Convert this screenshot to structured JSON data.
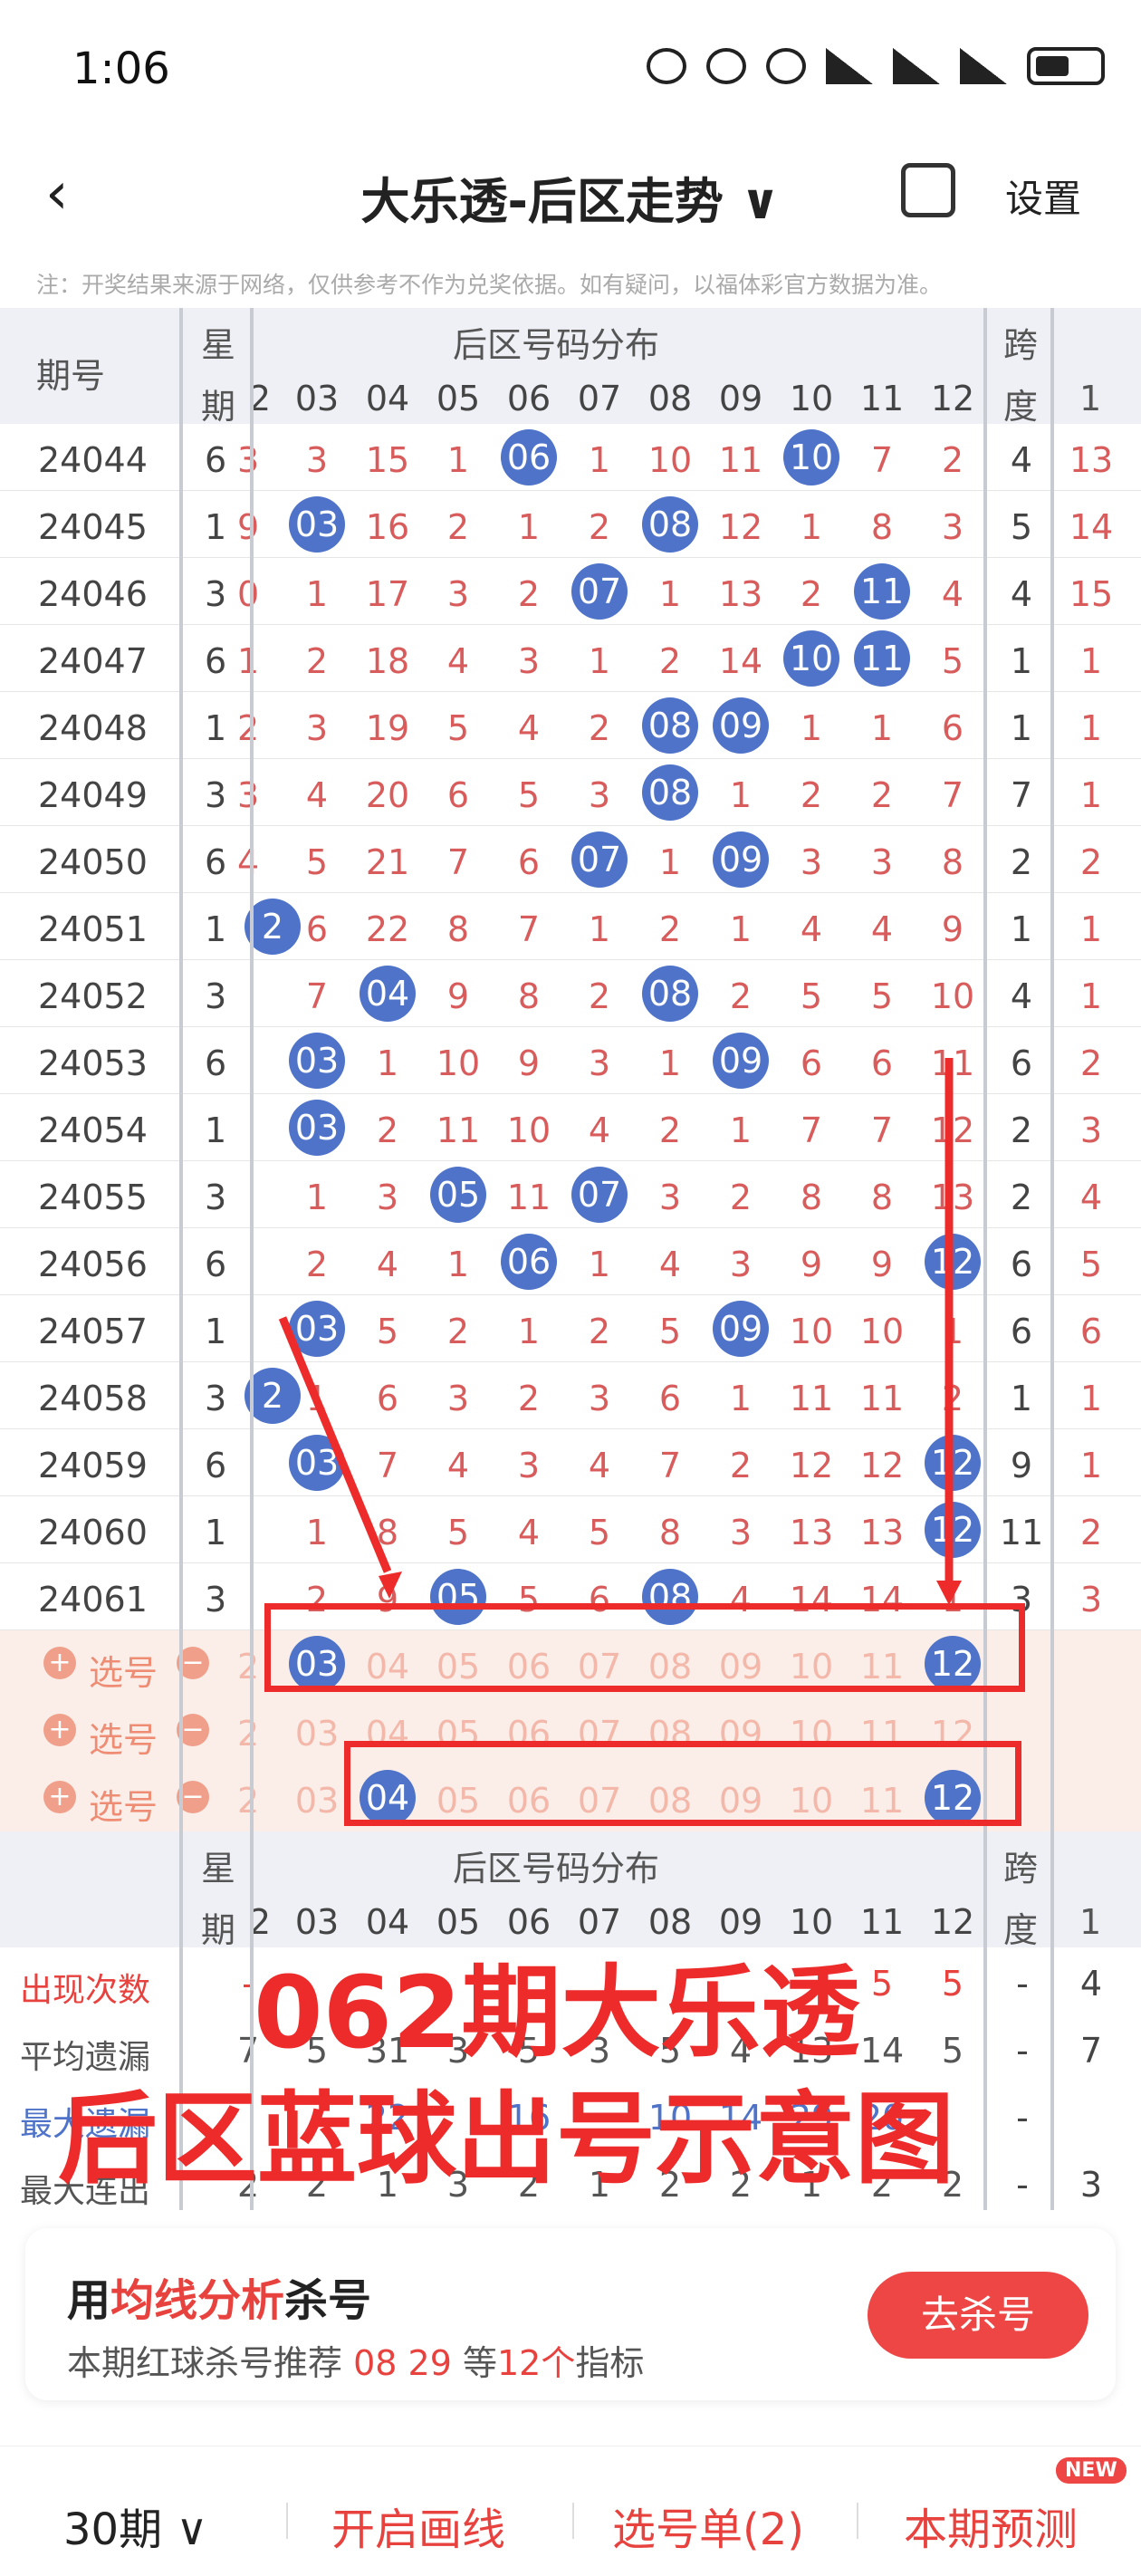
{
  "status": {
    "time": "1:06"
  },
  "nav": {
    "title": "大乐透-后区走势 ∨",
    "settings": "设置"
  },
  "notice": "注：开奖结果来源于网络，仅供参考不作为兑奖依据。如有疑问，以福体彩官方数据为准。",
  "header": {
    "issue_label": "期号",
    "week_label_1": "星",
    "week_label_2": "期",
    "dist_label": "后区号码分布",
    "span_label_1": "跨",
    "span_label_2": "度",
    "extra_col": "1",
    "columns": [
      "2",
      "03",
      "04",
      "05",
      "06",
      "07",
      "08",
      "09",
      "10",
      "11",
      "12"
    ]
  },
  "rows": [
    {
      "issue": "24044",
      "wk": "6",
      "cells": [
        "3",
        "3",
        "15",
        "1",
        "06",
        "1",
        "10",
        "11",
        "10",
        "7",
        "2"
      ],
      "span": "4",
      "s1": "13"
    },
    {
      "issue": "24045",
      "wk": "1",
      "cells": [
        "9",
        "03",
        "16",
        "2",
        "1",
        "2",
        "08",
        "12",
        "1",
        "8",
        "3"
      ],
      "span": "5",
      "s1": "14"
    },
    {
      "issue": "24046",
      "wk": "3",
      "cells": [
        "0",
        "1",
        "17",
        "3",
        "2",
        "07",
        "1",
        "13",
        "2",
        "11",
        "4"
      ],
      "span": "4",
      "s1": "15"
    },
    {
      "issue": "24047",
      "wk": "6",
      "cells": [
        "1",
        "2",
        "18",
        "4",
        "3",
        "1",
        "2",
        "14",
        "10",
        "11",
        "5"
      ],
      "span": "1",
      "s1": "1"
    },
    {
      "issue": "24048",
      "wk": "1",
      "cells": [
        "2",
        "3",
        "19",
        "5",
        "4",
        "2",
        "08",
        "09",
        "1",
        "1",
        "6"
      ],
      "span": "1",
      "s1": "1"
    },
    {
      "issue": "24049",
      "wk": "3",
      "cells": [
        "3",
        "4",
        "20",
        "6",
        "5",
        "3",
        "08",
        "1",
        "2",
        "2",
        "7"
      ],
      "span": "7",
      "s1": "1"
    },
    {
      "issue": "24050",
      "wk": "6",
      "cells": [
        "4",
        "5",
        "21",
        "7",
        "6",
        "07",
        "1",
        "09",
        "3",
        "3",
        "8"
      ],
      "span": "2",
      "s1": "2"
    },
    {
      "issue": "24051",
      "wk": "1",
      "cells": [
        "2",
        "6",
        "22",
        "8",
        "7",
        "1",
        "2",
        "1",
        "4",
        "4",
        "9"
      ],
      "span": "1",
      "s1": "1"
    },
    {
      "issue": "24052",
      "wk": "3",
      "cells": [
        "",
        "7",
        "04",
        "9",
        "8",
        "2",
        "08",
        "2",
        "5",
        "5",
        "10"
      ],
      "span": "4",
      "s1": "1"
    },
    {
      "issue": "24053",
      "wk": "6",
      "cells": [
        "",
        "03",
        "1",
        "10",
        "9",
        "3",
        "1",
        "09",
        "6",
        "6",
        "11"
      ],
      "span": "6",
      "s1": "2"
    },
    {
      "issue": "24054",
      "wk": "1",
      "cells": [
        "",
        "03",
        "2",
        "11",
        "10",
        "4",
        "2",
        "1",
        "7",
        "7",
        "12"
      ],
      "span": "2",
      "s1": "3"
    },
    {
      "issue": "24055",
      "wk": "3",
      "cells": [
        "",
        "1",
        "3",
        "05",
        "11",
        "07",
        "3",
        "2",
        "8",
        "8",
        "13"
      ],
      "span": "2",
      "s1": "4"
    },
    {
      "issue": "24056",
      "wk": "6",
      "cells": [
        "",
        "2",
        "4",
        "1",
        "06",
        "1",
        "4",
        "3",
        "9",
        "9",
        "12"
      ],
      "span": "6",
      "s1": "5"
    },
    {
      "issue": "24057",
      "wk": "1",
      "cells": [
        "",
        "03",
        "5",
        "2",
        "1",
        "2",
        "5",
        "09",
        "10",
        "10",
        "1"
      ],
      "span": "6",
      "s1": "6"
    },
    {
      "issue": "24058",
      "wk": "3",
      "cells": [
        "2",
        "1",
        "6",
        "3",
        "2",
        "3",
        "6",
        "1",
        "11",
        "11",
        "2"
      ],
      "span": "1",
      "s1": "1"
    },
    {
      "issue": "24059",
      "wk": "6",
      "cells": [
        "",
        "03",
        "7",
        "4",
        "3",
        "4",
        "7",
        "2",
        "12",
        "12",
        "12"
      ],
      "span": "9",
      "s1": "1"
    },
    {
      "issue": "24060",
      "wk": "1",
      "cells": [
        "",
        "1",
        "8",
        "5",
        "4",
        "5",
        "8",
        "3",
        "13",
        "13",
        "12"
      ],
      "span": "11",
      "s1": "2"
    },
    {
      "issue": "24061",
      "wk": "3",
      "cells": [
        "",
        "2",
        "9",
        "05",
        "5",
        "6",
        "08",
        "4",
        "14",
        "14",
        "1"
      ],
      "span": "3",
      "s1": "3"
    }
  ],
  "balls": [
    [
      false,
      false,
      false,
      false,
      true,
      false,
      false,
      false,
      true,
      false,
      false
    ],
    [
      false,
      true,
      false,
      false,
      false,
      false,
      true,
      false,
      false,
      false,
      false
    ],
    [
      false,
      false,
      false,
      false,
      false,
      true,
      false,
      false,
      false,
      true,
      false
    ],
    [
      false,
      false,
      false,
      false,
      false,
      false,
      false,
      false,
      true,
      true,
      false
    ],
    [
      false,
      false,
      false,
      false,
      false,
      false,
      true,
      true,
      false,
      false,
      false
    ],
    [
      false,
      false,
      false,
      false,
      false,
      false,
      true,
      false,
      false,
      false,
      false
    ],
    [
      false,
      false,
      false,
      false,
      false,
      true,
      false,
      true,
      false,
      false,
      false
    ],
    [
      true,
      false,
      false,
      false,
      false,
      false,
      false,
      false,
      false,
      false,
      false
    ],
    [
      false,
      false,
      true,
      false,
      false,
      false,
      true,
      false,
      false,
      false,
      false
    ],
    [
      false,
      true,
      false,
      false,
      false,
      false,
      false,
      true,
      false,
      false,
      false
    ],
    [
      false,
      true,
      false,
      false,
      false,
      false,
      false,
      false,
      false,
      false,
      false
    ],
    [
      false,
      false,
      false,
      true,
      false,
      true,
      false,
      false,
      false,
      false,
      false
    ],
    [
      false,
      false,
      false,
      false,
      true,
      false,
      false,
      false,
      false,
      false,
      true
    ],
    [
      false,
      true,
      false,
      false,
      false,
      false,
      false,
      true,
      false,
      false,
      false
    ],
    [
      true,
      false,
      false,
      false,
      false,
      false,
      false,
      false,
      false,
      false,
      false
    ],
    [
      false,
      true,
      false,
      false,
      false,
      false,
      false,
      false,
      false,
      false,
      true
    ],
    [
      false,
      false,
      false,
      false,
      false,
      false,
      false,
      false,
      false,
      false,
      true
    ],
    [
      false,
      false,
      false,
      true,
      false,
      false,
      true,
      false,
      false,
      false,
      false
    ]
  ],
  "picks": [
    {
      "label": "选号",
      "cells": [
        "2",
        "03",
        "04",
        "05",
        "06",
        "07",
        "08",
        "09",
        "10",
        "11",
        "12"
      ],
      "selected": [
        1,
        10
      ]
    },
    {
      "label": "选号",
      "cells": [
        "2",
        "03",
        "04",
        "05",
        "06",
        "07",
        "08",
        "09",
        "10",
        "11",
        "12"
      ],
      "selected": []
    },
    {
      "label": "选号",
      "cells": [
        "2",
        "03",
        "04",
        "05",
        "06",
        "07",
        "08",
        "09",
        "10",
        "11",
        "12"
      ],
      "selected": [
        2,
        10
      ]
    }
  ],
  "stats": [
    {
      "label": "出现次数",
      "color": "#e8423f",
      "cells": [
        "-",
        "",
        "",
        "",
        "",
        "",
        "",
        "",
        "",
        "5",
        "5"
      ],
      "span": "-",
      "s1": "4"
    },
    {
      "label": "平均遗漏",
      "color": "#555555",
      "cells": [
        "7",
        "5",
        "31",
        "3",
        "5",
        "3",
        "5",
        "4",
        "13",
        "14",
        "5"
      ],
      "span": "-",
      "s1": "7"
    },
    {
      "label": "最大遗漏",
      "color": "#4e73c8",
      "cells": [
        "",
        "",
        "22",
        "",
        "16",
        "",
        "10",
        "14",
        "29",
        "20",
        ""
      ],
      "span": "-",
      "s1": ""
    },
    {
      "label": "最大连出",
      "color": "#555555",
      "cells": [
        "2",
        "2",
        "1",
        "3",
        "2",
        "1",
        "2",
        "2",
        "1",
        "2",
        "2"
      ],
      "span": "-",
      "s1": "3"
    }
  ],
  "overlay": {
    "line1": "062期大乐透",
    "line2": "后区蓝球出号示意图"
  },
  "card": {
    "title_pre": "用",
    "title_hl": "均线分析",
    "title_post": "杀号",
    "sub_pre": "本期红球杀号推荐 ",
    "sub_nums": "08 29",
    "sub_mid": " 等",
    "sub_count": "12个",
    "sub_post": "指标",
    "button": "去杀号"
  },
  "bottom": {
    "period": "30期 ∨",
    "draw_line": "开启画线",
    "pick_list": "选号单(2)",
    "predict": "本期预测",
    "new_badge": "NEW"
  }
}
